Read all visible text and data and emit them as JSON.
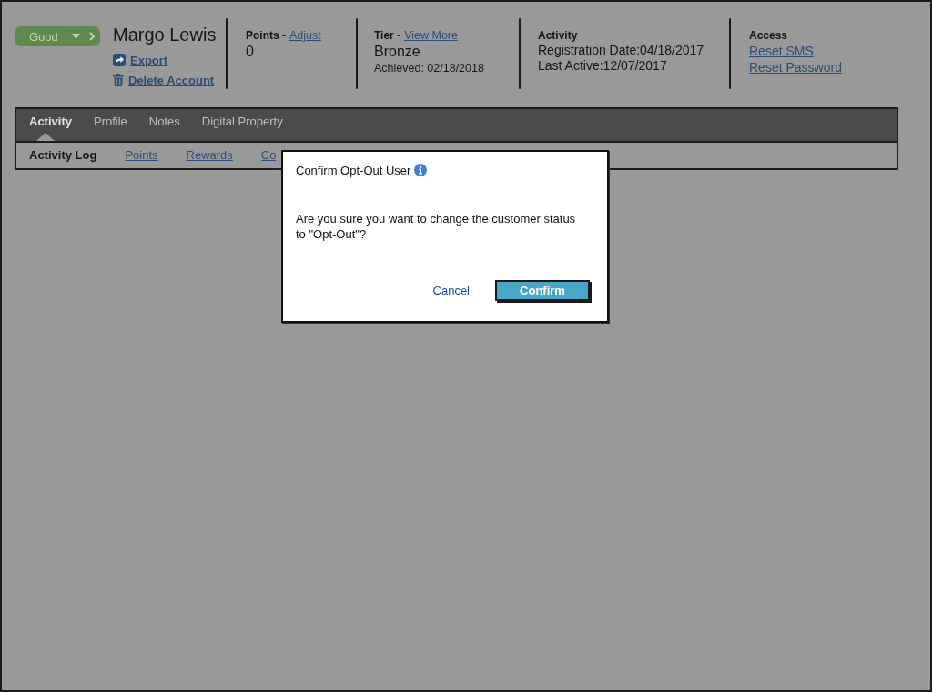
{
  "status": {
    "label": "Good"
  },
  "customer": {
    "name": "Margo Lewis",
    "actions": [
      {
        "kind": "export",
        "label": "Export"
      },
      {
        "kind": "delete",
        "label": "Delete Account"
      }
    ]
  },
  "summary": [
    {
      "heading": "Points -",
      "link": "Adjust",
      "lines": [
        {
          "kind": "value",
          "text": "0"
        }
      ]
    },
    {
      "heading": "Tier -",
      "link": "View More",
      "lines": [
        {
          "kind": "value",
          "text": "Bronze"
        },
        {
          "kind": "note",
          "text": "Achieved: 02/18/2018"
        }
      ]
    },
    {
      "heading": "Activity",
      "lines": [
        {
          "kind": "detail",
          "text": "Registration Date:04/18/2017"
        },
        {
          "kind": "detail",
          "text": "Last Active:12/07/2017"
        }
      ]
    },
    {
      "heading": "Access",
      "lines": [
        {
          "kind": "link",
          "text": "Reset SMS"
        },
        {
          "kind": "link",
          "text": "Reset Password"
        }
      ]
    }
  ],
  "tabs": [
    {
      "label": "Activity",
      "selected": true
    },
    {
      "label": "Profile",
      "selected": false
    },
    {
      "label": "Notes",
      "selected": false
    },
    {
      "label": "Digital Property",
      "selected": false
    }
  ],
  "sub_tabs": [
    {
      "label": "Activity Log",
      "selected": true
    },
    {
      "label": "Points",
      "selected": false
    },
    {
      "label": "Rewards",
      "selected": false
    },
    {
      "label": "Co",
      "selected": false
    }
  ],
  "dialog": {
    "title": "Confirm Opt-Out User",
    "message": "Are you sure you want to change the customer status to \"Opt-Out\"?",
    "buttons": [
      {
        "kind": "link",
        "label": "Cancel"
      },
      {
        "kind": "primary",
        "label": "Confirm"
      }
    ]
  }
}
